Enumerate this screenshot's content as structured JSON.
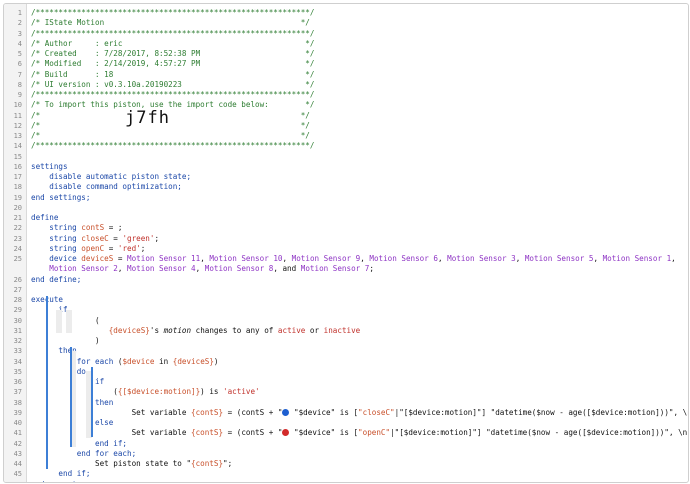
{
  "lines": [
    {
      "n": "1",
      "parts": [
        [
          "cm",
          "/************************************************************/"
        ]
      ]
    },
    {
      "n": "2",
      "parts": [
        [
          "cm",
          "/* IState Motion                                           */"
        ]
      ]
    },
    {
      "n": "3",
      "parts": [
        [
          "cm",
          "/************************************************************/"
        ]
      ]
    },
    {
      "n": "4",
      "parts": [
        [
          "cm",
          "/* Author     : eric                                        */"
        ]
      ]
    },
    {
      "n": "5",
      "parts": [
        [
          "cm",
          "/* Created    : 7/28/2017, 8:52:38 PM                       */"
        ]
      ]
    },
    {
      "n": "6",
      "parts": [
        [
          "cm",
          "/* Modified   : 2/14/2019, 4:57:27 PM                       */"
        ]
      ]
    },
    {
      "n": "7",
      "parts": [
        [
          "cm",
          "/* Build      : 18                                          */"
        ]
      ]
    },
    {
      "n": "8",
      "parts": [
        [
          "cm",
          "/* UI version : v0.3.10a.20190223                           */"
        ]
      ]
    },
    {
      "n": "9",
      "parts": [
        [
          "cm",
          "/************************************************************/"
        ]
      ]
    },
    {
      "n": "10",
      "parts": [
        [
          "cm",
          "/* To import this piston, use the import code below:        */"
        ]
      ]
    },
    {
      "n": "11",
      "parts": [
        [
          "cm",
          "/*                                                         */"
        ]
      ]
    },
    {
      "n": "12",
      "parts": [
        [
          "cm",
          "/*                                                         */"
        ]
      ]
    },
    {
      "n": "13",
      "parts": [
        [
          "cm",
          "/*                                                         */"
        ]
      ]
    },
    {
      "n": "14",
      "parts": [
        [
          "cm",
          "/************************************************************/"
        ]
      ]
    },
    {
      "n": "15",
      "parts": []
    },
    {
      "n": "16",
      "parts": [
        [
          "kw",
          "settings"
        ]
      ]
    },
    {
      "n": "17",
      "parts": [
        [
          "kw",
          "    disable automatic piston state;"
        ]
      ]
    },
    {
      "n": "18",
      "parts": [
        [
          "kw",
          "    disable command optimization;"
        ]
      ]
    },
    {
      "n": "19",
      "parts": [
        [
          "kw",
          "end settings;"
        ]
      ]
    },
    {
      "n": "20",
      "parts": []
    },
    {
      "n": "21",
      "parts": [
        [
          "kw",
          "define"
        ]
      ]
    },
    {
      "n": "22",
      "parts": [
        [
          "kw",
          "    string "
        ],
        [
          "var",
          "contS"
        ],
        [
          "op",
          " = ;"
        ]
      ]
    },
    {
      "n": "23",
      "parts": [
        [
          "kw",
          "    string "
        ],
        [
          "var",
          "closeC"
        ],
        [
          "op",
          " = "
        ],
        [
          "str",
          "'green'"
        ],
        [
          "op",
          ";"
        ]
      ]
    },
    {
      "n": "24",
      "parts": [
        [
          "kw",
          "    string "
        ],
        [
          "var",
          "openC"
        ],
        [
          "op",
          " = "
        ],
        [
          "str",
          "'red'"
        ],
        [
          "op",
          ";"
        ]
      ]
    },
    {
      "n": "25",
      "parts": [
        [
          "kw",
          "    device "
        ],
        [
          "var",
          "deviceS"
        ],
        [
          "op",
          " = "
        ],
        [
          "dev",
          "Motion Sensor 11"
        ],
        [
          "op",
          ", "
        ],
        [
          "dev",
          "Motion Sensor 10"
        ],
        [
          "op",
          ", "
        ],
        [
          "dev",
          "Motion Sensor 9"
        ],
        [
          "op",
          ", "
        ],
        [
          "dev",
          "Motion Sensor 6"
        ],
        [
          "op",
          ", "
        ],
        [
          "dev",
          "Motion Sensor 3"
        ],
        [
          "op",
          ", "
        ],
        [
          "dev",
          "Motion Sensor 5"
        ],
        [
          "op",
          ", "
        ],
        [
          "dev",
          "Motion Sensor 1"
        ],
        [
          "op",
          ","
        ]
      ]
    },
    {
      "n": "",
      "parts": [
        [
          "dev",
          "    Motion Sensor 2"
        ],
        [
          "op",
          ", "
        ],
        [
          "dev",
          "Motion Sensor 4"
        ],
        [
          "op",
          ", "
        ],
        [
          "dev",
          "Motion Sensor 8"
        ],
        [
          "op",
          ", and "
        ],
        [
          "dev",
          "Motion Sensor 7"
        ],
        [
          "op",
          ";"
        ]
      ]
    },
    {
      "n": "26",
      "parts": [
        [
          "kw",
          "end define;"
        ]
      ]
    },
    {
      "n": "27",
      "parts": []
    },
    {
      "n": "28",
      "parts": [
        [
          "kw",
          "execute"
        ]
      ]
    },
    {
      "n": "29",
      "parts": [
        [
          "kw",
          "      if"
        ]
      ]
    },
    {
      "n": "30",
      "parts": [
        [
          "op",
          "              ("
        ]
      ]
    },
    {
      "n": "31",
      "parts": [
        [
          "op",
          "                 "
        ],
        [
          "var",
          "{deviceS}"
        ],
        [
          "op",
          "'s "
        ],
        [
          "em",
          "motion"
        ],
        [
          "op",
          " changes to any of "
        ],
        [
          "str",
          "active"
        ],
        [
          "op",
          " or "
        ],
        [
          "str",
          "inactive"
        ]
      ]
    },
    {
      "n": "32",
      "parts": [
        [
          "op",
          "              )"
        ]
      ]
    },
    {
      "n": "33",
      "parts": [
        [
          "kw",
          "      then"
        ]
      ]
    },
    {
      "n": "34",
      "parts": [
        [
          "kw",
          "          for each "
        ],
        [
          "op",
          "("
        ],
        [
          "var",
          "$device"
        ],
        [
          "op",
          " in "
        ],
        [
          "var",
          "{deviceS}"
        ],
        [
          "op",
          ")"
        ]
      ]
    },
    {
      "n": "35",
      "parts": [
        [
          "kw",
          "          do"
        ]
      ]
    },
    {
      "n": "36",
      "parts": [
        [
          "kw",
          "              if"
        ]
      ]
    },
    {
      "n": "37",
      "parts": [
        [
          "op",
          "                  ("
        ],
        [
          "var",
          "{[$device:motion]}"
        ],
        [
          "op",
          ") is "
        ],
        [
          "str",
          "'active'"
        ]
      ]
    },
    {
      "n": "38",
      "parts": [
        [
          "kw",
          "              then"
        ]
      ]
    },
    {
      "n": "39",
      "parts": [
        [
          "op",
          "                      Set variable "
        ],
        [
          "var",
          "{contS}"
        ],
        [
          "op",
          " = (contS + \""
        ],
        [
          "dot",
          "#1e5fd0"
        ],
        [
          "op",
          " \"$device\" is ["
        ],
        [
          "var",
          "\"closeC\""
        ],
        [
          "op",
          "|\"[$device:motion]\"] \"datetime($now - age([$device:motion]))\", \\n\");"
        ]
      ]
    },
    {
      "n": "40",
      "parts": [
        [
          "kw",
          "              else"
        ]
      ]
    },
    {
      "n": "41",
      "parts": [
        [
          "op",
          "                      Set variable "
        ],
        [
          "var",
          "{contS}"
        ],
        [
          "op",
          " = (contS + \""
        ],
        [
          "dot",
          "#d22a2a"
        ],
        [
          "op",
          " \"$device\" is ["
        ],
        [
          "var",
          "\"openC\""
        ],
        [
          "op",
          "|\"[$device:motion]\"] \"datetime($now - age([$device:motion]))\", \\n\");"
        ]
      ]
    },
    {
      "n": "42",
      "parts": [
        [
          "kw",
          "              end if;"
        ]
      ]
    },
    {
      "n": "43",
      "parts": [
        [
          "kw",
          "          end for each;"
        ]
      ]
    },
    {
      "n": "44",
      "parts": [
        [
          "op",
          "              Set piston state to \""
        ],
        [
          "var",
          "{contS}"
        ],
        [
          "op",
          "\";"
        ]
      ]
    },
    {
      "n": "45",
      "parts": [
        [
          "kw",
          "      end if;"
        ]
      ]
    },
    {
      "n": "46",
      "parts": [
        [
          "kw",
          "end execute;"
        ]
      ]
    }
  ],
  "import_code": "j7fh",
  "colors": {
    "accent_bar": "#3d7fd6",
    "comment": "#2e7d32",
    "keyword": "#1c48a8",
    "variable": "#c8502b",
    "string": "#c0312b",
    "device": "#8e34c4"
  }
}
